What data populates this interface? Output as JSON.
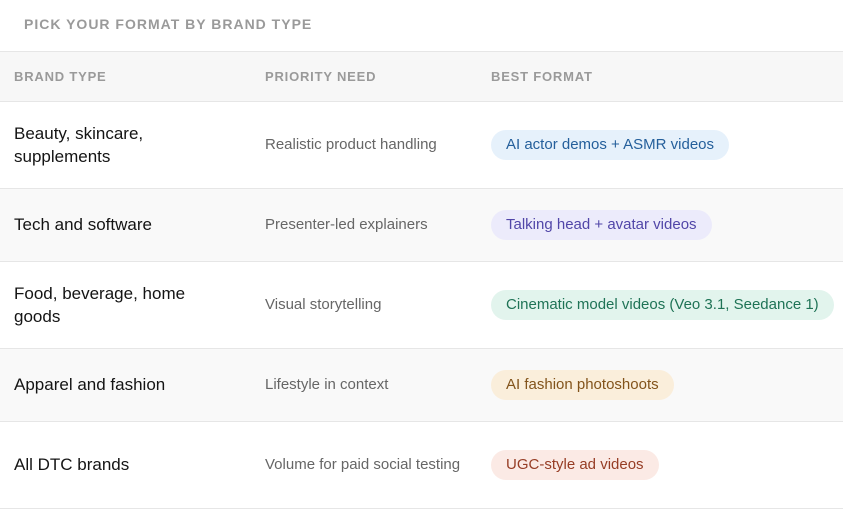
{
  "section_title": "PICK YOUR FORMAT BY BRAND TYPE",
  "headers": {
    "brand_type": "BRAND TYPE",
    "priority_need": "PRIORITY NEED",
    "best_format": "BEST FORMAT"
  },
  "rows": [
    {
      "brand_type": "Beauty, skincare, supplements",
      "priority_need": "Realistic product handling",
      "best_format": "AI actor demos + ASMR videos",
      "pill_color": "#e6f1fb"
    },
    {
      "brand_type": "Tech and software",
      "priority_need": "Presenter-led explainers",
      "best_format": "Talking head + avatar videos",
      "pill_color": "#ecebfb"
    },
    {
      "brand_type": "Food, beverage, home goods",
      "priority_need": "Visual storytelling",
      "best_format": "Cinematic model videos (Veo 3.1, Seedance 1)",
      "pill_color": "#e2f4ed"
    },
    {
      "brand_type": "Apparel and fashion",
      "priority_need": "Lifestyle in context",
      "best_format": "AI fashion photoshoots",
      "pill_color": "#faeedb"
    },
    {
      "brand_type": "All DTC brands",
      "priority_need": "Volume for paid social testing",
      "best_format": "UGC-style ad videos",
      "pill_color": "#fbeae5"
    }
  ]
}
